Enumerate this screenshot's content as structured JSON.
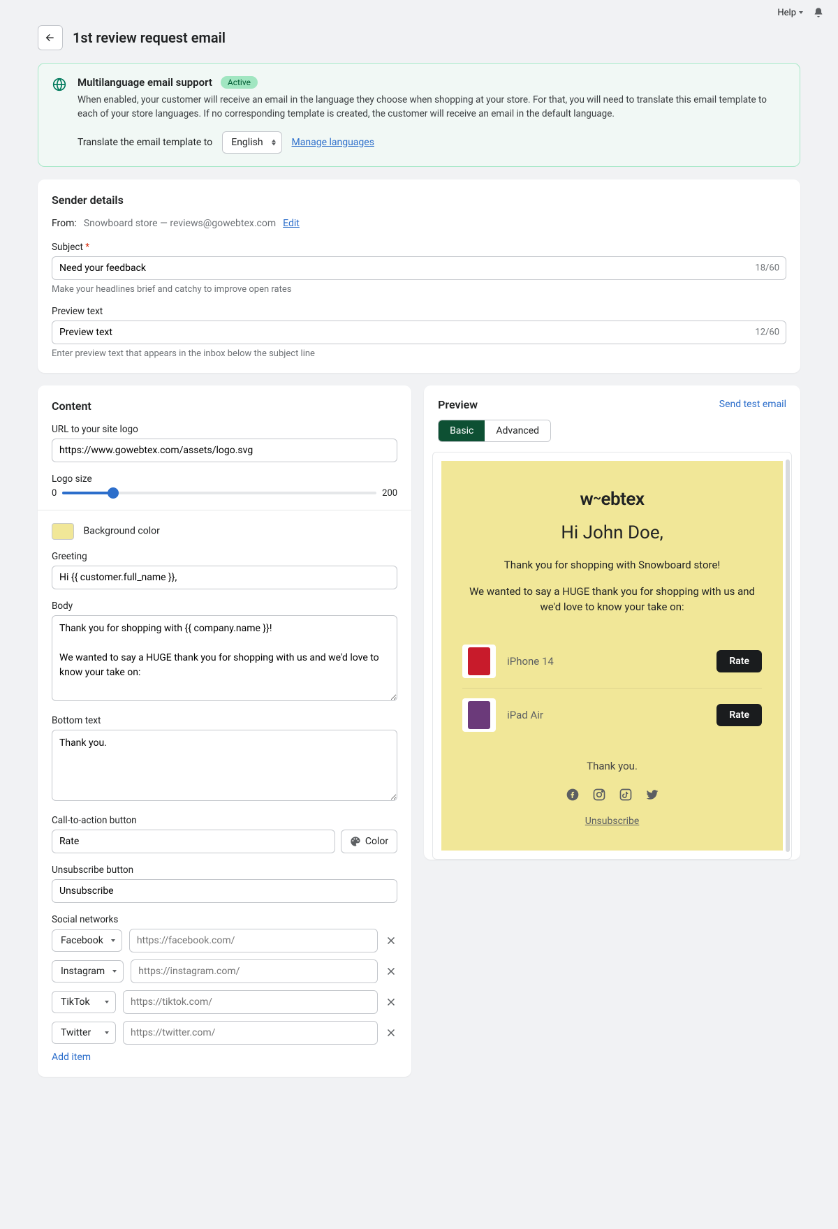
{
  "topbar": {
    "help": "Help"
  },
  "page_title": "1st review request email",
  "banner": {
    "title": "Multilanguage email support",
    "badge": "Active",
    "description": "When enabled, your customer will receive an email in the language they choose when shopping at your store. For that, you will need to translate this email template to each of your store languages. If no corresponding template is created, the customer will receive an email in the default language.",
    "translate_label": "Translate the email template to",
    "language": "English",
    "manage_link": "Manage languages"
  },
  "sender": {
    "section_title": "Sender details",
    "from_label": "From:",
    "from_value": "Snowboard store — reviews@gowebtex.com",
    "edit": "Edit",
    "subject_label": "Subject",
    "subject_value": "Need your feedback",
    "subject_counter": "18/60",
    "subject_help": "Make your headlines brief and catchy to improve open rates",
    "preview_label": "Preview text",
    "preview_value": "Preview text",
    "preview_counter": "12/60",
    "preview_help": "Enter preview text that appears in the inbox below the subject line"
  },
  "content": {
    "section_title": "Content",
    "logo_url_label": "URL to your site logo",
    "logo_url_value": "https://www.gowebtex.com/assets/logo.svg",
    "logo_size_label": "Logo size",
    "logo_size_min": "0",
    "logo_size_max": "200",
    "bg_color_label": "Background color",
    "bg_color": "#f1e798",
    "greeting_label": "Greeting",
    "greeting_value": "Hi {{ customer.full_name }},",
    "body_label": "Body",
    "body_value": "Thank you for shopping with {{ company.name }}!\n\nWe wanted to say a HUGE thank you for shopping with us and we'd love to know your take on:",
    "bottom_label": "Bottom text",
    "bottom_value": "Thank you.",
    "cta_label": "Call-to-action button",
    "cta_value": "Rate",
    "color_btn": "Color",
    "unsub_label": "Unsubscribe button",
    "unsub_value": "Unsubscribe",
    "social_label": "Social networks",
    "socials": [
      {
        "name": "Facebook",
        "placeholder": "https://facebook.com/"
      },
      {
        "name": "Instagram",
        "placeholder": "https://instagram.com/"
      },
      {
        "name": "TikTok",
        "placeholder": "https://tiktok.com/"
      },
      {
        "name": "Twitter",
        "placeholder": "https://twitter.com/"
      }
    ],
    "add_item": "Add item"
  },
  "preview": {
    "title": "Preview",
    "send_test": "Send test email",
    "tab_basic": "Basic",
    "tab_advanced": "Advanced",
    "email": {
      "logo": "webtex",
      "greeting": "Hi John Doe,",
      "line1": "Thank you for shopping with Snowboard store!",
      "line2": "We wanted to say a HUGE thank you for shopping with us and we'd love to know your take on:",
      "products": [
        {
          "name": "iPhone 14",
          "thumb_color": "#c81b2b"
        },
        {
          "name": "iPad Air",
          "thumb_color": "#6b3a7a"
        }
      ],
      "rate": "Rate",
      "thanks": "Thank you.",
      "unsubscribe": "Unsubscribe"
    }
  }
}
